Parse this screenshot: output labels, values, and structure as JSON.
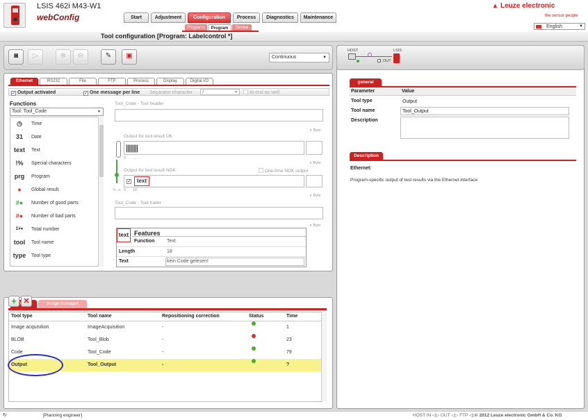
{
  "header": {
    "product": "LSIS 462i M43-W1",
    "app_name": "webConfig",
    "brand": "Leuze electronic",
    "tagline": "the sensor people",
    "language": "English",
    "main_tabs": [
      "Start",
      "Adjustment",
      "Configuration",
      "Process",
      "Diagnostics",
      "Maintenance"
    ],
    "active_main_tab": "Configuration",
    "sub_tabs": [
      "Programs",
      "Program",
      "Device"
    ],
    "active_sub_tab": "Program"
  },
  "title_bar": "Tool configuration   [Program: Labelcontrol *]",
  "toolbar": {
    "icons": [
      "camera-icon",
      "play-icon",
      "zoom-in-icon",
      "zoom-out-icon",
      "wrench-icon",
      "save-icon"
    ],
    "mode": "Continuous"
  },
  "editor": {
    "tabs": [
      "Ethernet",
      "RS232",
      "File",
      "FTP",
      "Process",
      "Display",
      "Digital I/O"
    ],
    "active_tab": "Ethernet",
    "output_activated_label": "Output activated",
    "one_message_label": "One message per line",
    "separator_label": "Separator character",
    "separator_value": "/",
    "at_end_label": "At end as well",
    "header_label": "Tool_Code - Tool header",
    "ok_label": "Output for tool result OK",
    "nok_label": "Output for tool result NOK",
    "one_time_nok_label": "One-time NOK output",
    "trailer_label": "Tool_Code - Tool trailer",
    "byte_label": "Byte",
    "ok_scale_zero": "0",
    "ok_scale_dots": "...",
    "nok_scale_range": "0...n",
    "nok_scale_zero": "0",
    "nok_scale_value": "18",
    "nok_item": "text"
  },
  "functions": {
    "title": "Functions",
    "selected_tool": "Tool: Tool_Code",
    "items": [
      {
        "icon": "clock-icon",
        "glyph": "◷",
        "label": "Time"
      },
      {
        "icon": "calendar-icon",
        "glyph": "31",
        "label": "Date"
      },
      {
        "icon": "text-icon",
        "glyph": "text",
        "label": "Text"
      },
      {
        "icon": "special-char-icon",
        "glyph": "!%",
        "label": "Special characters"
      },
      {
        "icon": "program-icon",
        "glyph": "prg",
        "label": "Program"
      },
      {
        "icon": "global-result-icon",
        "glyph": "●",
        "label": "Global result"
      },
      {
        "icon": "good-parts-icon",
        "glyph": "#●",
        "label": "Number of good parts"
      },
      {
        "icon": "bad-parts-icon",
        "glyph": "#●",
        "label": "Number of bad parts"
      },
      {
        "icon": "total-number-icon",
        "glyph": "Σ#●",
        "label": "Total number"
      },
      {
        "icon": "tool-name-icon",
        "glyph": "tool",
        "label": "Tool name"
      },
      {
        "icon": "tool-type-icon",
        "glyph": "type",
        "label": "Tool type"
      }
    ]
  },
  "features": {
    "title": "Features",
    "icon_text": "text",
    "rows": [
      {
        "label": "Function",
        "value": "Text"
      },
      {
        "label": "Length",
        "value": "18"
      },
      {
        "label": "Text",
        "value": "kein Code gelesen!"
      }
    ]
  },
  "tools_panel": {
    "tabs": [
      "Tools",
      "Image manager"
    ],
    "active_tab": "Tools",
    "columns": [
      "Tool type",
      "Tool name",
      "Repositioning correction",
      "Status",
      "Time"
    ],
    "rows": [
      {
        "type": "Image acquisition",
        "name": "ImageAcquisition",
        "repos": "-",
        "status": "green",
        "time": "1"
      },
      {
        "type": "BLOB",
        "name": "Tool_Blob",
        "repos": "-",
        "status": "red",
        "time": "23"
      },
      {
        "type": "Code",
        "name": "Tool_Code",
        "repos": "-",
        "status": "green",
        "time": "79"
      },
      {
        "type": "Output",
        "name": "Tool_Output",
        "repos": "-",
        "status": "green",
        "time": "?"
      }
    ],
    "selected_row": 3
  },
  "right_panel": {
    "host_label": "HOST",
    "device_label": "LSIS",
    "out_label": "OUT",
    "general_tab": "general",
    "columns": [
      "Parameter",
      "Value"
    ],
    "params": [
      {
        "label": "Tool type",
        "value": "Output"
      },
      {
        "label": "Tool name",
        "value": "Tool_Output"
      },
      {
        "label": "Description",
        "value": ""
      }
    ],
    "description_tab": "Description",
    "description_heading": "Ethernet:",
    "description_text": "Program-specific output of test results via the Ethernet interface"
  },
  "footer": {
    "user": "[Planning engineer]",
    "status": "HOST IN ◁▷ OUT ◁▷ FTP ◁▷",
    "copyright": "© 2012 Leuze electronic GmbH & Co. KG"
  },
  "colors": {
    "accent": "#cc2222",
    "selection": "#f7f28a",
    "ok": "#4caf2a",
    "error": "#d63030",
    "annotation": "#2a2ad0"
  }
}
